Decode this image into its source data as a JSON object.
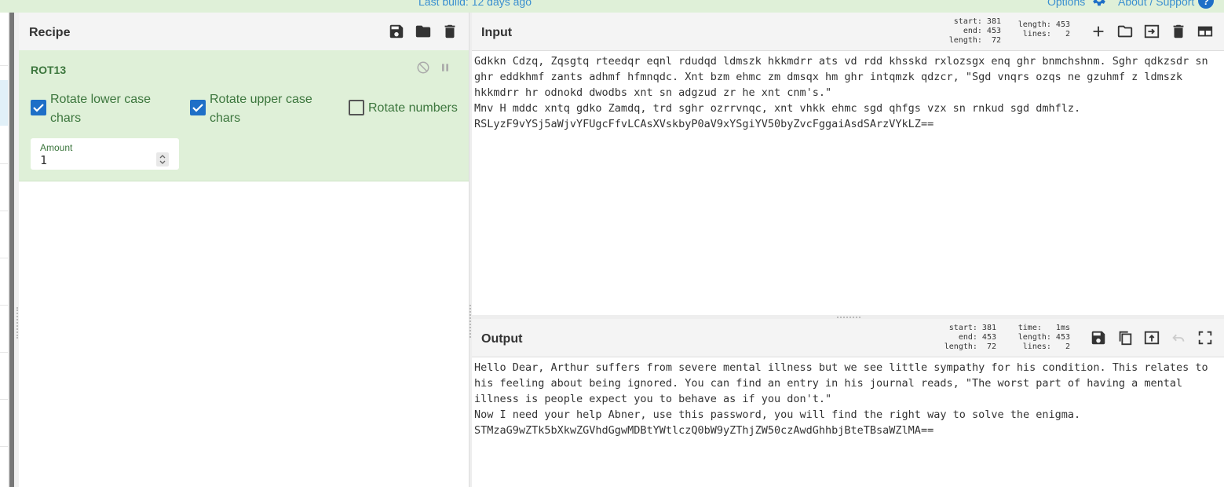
{
  "topbar": {
    "build_text": "Last build: 12 days ago",
    "options_label": "Options",
    "about_label": "About / Support",
    "help_glyph": "?"
  },
  "recipe": {
    "title": "Recipe",
    "icons": [
      "save-icon",
      "folder-icon",
      "trash-icon"
    ],
    "operation": {
      "name": "ROT13",
      "rotate_lower": {
        "label": "Rotate lower case chars",
        "checked": true
      },
      "rotate_upper": {
        "label": "Rotate upper case chars",
        "checked": true
      },
      "rotate_numbers": {
        "label": "Rotate numbers",
        "checked": false
      },
      "amount": {
        "label": "Amount",
        "value": "1"
      }
    }
  },
  "input": {
    "title": "Input",
    "stats": {
      "start": "start: 381",
      "end": "end: 453",
      "length_sel": "length:  72",
      "length": "length: 453",
      "lines": "lines:   2"
    },
    "icons": [
      "plus-icon",
      "folder-icon",
      "import-icon",
      "trash-icon",
      "layout-icon"
    ],
    "text": "Gdkkn Cdzq, Zqsgtq rteedqr eqnl rdudqd ldmszk hkkmdrr ats vd rdd khsskd rxlozsgx enq ghr bnmchshnm. Sghr qdkzsdr sn ghr eddkhmf zants adhmf hfmnqdc. Xnt bzm ehmc zm dmsqx hm ghr intqmzk qdzcr, \"Sgd vnqrs ozqs ne gzuhmf z ldmszk hkkmdrr hr odnokd dwodbs xnt sn adgzud zr he xnt cnm's.\"\nMnv H mddc xntq gdko Zamdq, trd sghr ozrrvnqc, xnt vhkk ehmc sgd qhfgs vzx sn rnkud sgd dmhflz.\nRSLyzF9vYSj5aWjvYFUgcFfvLCAsXVskbyP0aV9xYSgiYV50byZvcFggaiAsdSArzVYkLZ=="
  },
  "output": {
    "title": "Output",
    "stats": {
      "start": "start: 381",
      "end": "end: 453",
      "length_sel": "length:  72",
      "time": "time:   1ms",
      "length": "length: 453",
      "lines": "lines:   2"
    },
    "icons": [
      "save-icon",
      "copy-icon",
      "replace-input-icon",
      "undo-icon",
      "maximize-icon"
    ],
    "text": "Hello Dear, Arthur suffers from severe mental illness but we see little sympathy for his condition. This relates to his feeling about being ignored. You can find an entry in his journal reads, \"The worst part of having a mental illness is people expect you to behave as if you don't.\"\nNow I need your help Abner, use this password, you will find the right way to solve the enigma.\nSTMzaG9wZTk5bXkwZGVhdGgwMDBtYWtlczQ0bW9yZThjZW50czAwdGhhbjBteTBsaWZlMA=="
  },
  "colors": {
    "accent": "#1e6fc7",
    "op_bg": "#dff0d8",
    "op_text": "#3c763d",
    "link": "#3a8fd0"
  }
}
